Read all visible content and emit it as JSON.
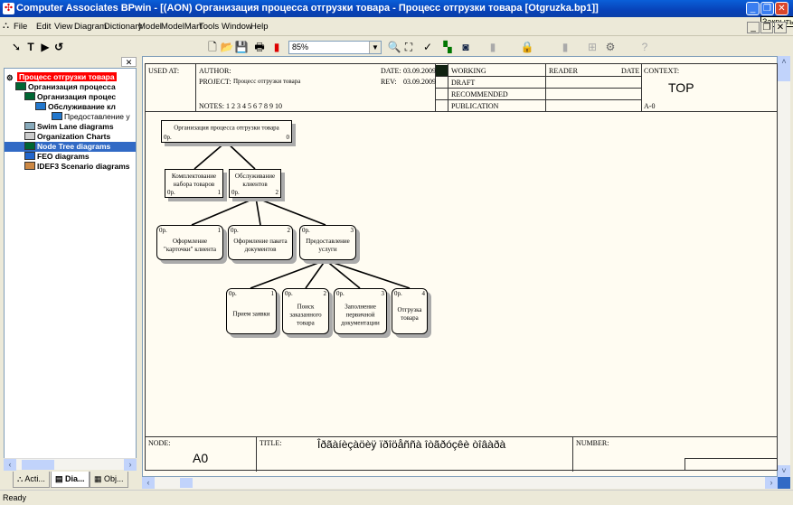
{
  "window": {
    "title": "Computer Associates BPwin - [(AON) Организация процесса отгрузки товара - Процесс отгрузки товара  [Otgruzka.bp1]]",
    "tooltip": "Закрыть"
  },
  "menu": [
    "File",
    "Edit",
    "View",
    "Diagram",
    "Dictionary",
    "Model",
    "ModelMart",
    "Tools",
    "Window",
    "Help"
  ],
  "toolbar": {
    "zoom": "85%"
  },
  "tree": {
    "items": [
      {
        "label": "Процесс отгрузки товара",
        "selected_red": true
      },
      {
        "label": "Организация процесса"
      },
      {
        "label": "Организация процес"
      },
      {
        "label": "Обслуживание кл"
      },
      {
        "label": "Предоставление у"
      },
      {
        "label": "Swim Lane diagrams"
      },
      {
        "label": "Organization Charts"
      },
      {
        "label": "Node Tree diagrams",
        "selected": true
      },
      {
        "label": "FEO diagrams"
      },
      {
        "label": "IDEF3 Scenario diagrams"
      }
    ],
    "tabs": [
      "Acti...",
      "Dia...",
      "Obj..."
    ]
  },
  "header": {
    "used_at": "USED AT:",
    "author": "AUTHOR:",
    "project_label": "PROJECT:",
    "project": "Процесс отгрузки товара",
    "date_label": "DATE:",
    "date": "03.09.2009",
    "rev_label": "REV:",
    "rev": "03.09.2009",
    "notes": "NOTES:  1  2  3  4  5  6  7  8  9  10",
    "status": [
      "WORKING",
      "DRAFT",
      "RECOMMENDED",
      "PUBLICATION"
    ],
    "reader": "READER",
    "reader_date": "DATE",
    "context": "CONTEXT:",
    "context_value": "TOP",
    "context_node": "A-0"
  },
  "footer": {
    "node_label": "NODE:",
    "node": "A0",
    "title_label": "TITLE:",
    "title": "Îðãàíèçàöèÿ ïðîöåññà îòãðóçêè òîâàðà",
    "number_label": "NUMBER:"
  },
  "diagram": {
    "op": "0р.",
    "nodes": [
      {
        "label": "Организация процесса отгрузки товара",
        "num": "0"
      },
      {
        "label": "Комплектование набора товаров",
        "num": "1"
      },
      {
        "label": "Обслуживание клиентов",
        "num": "2"
      },
      {
        "label": "Оформление \"карточки\" клиента",
        "num": "1"
      },
      {
        "label": "Оформление пакета документов",
        "num": "2"
      },
      {
        "label": "Предоставление услуги",
        "num": "3"
      },
      {
        "label": "Прием заявки",
        "num": "1"
      },
      {
        "label": "Поиск заказанного товара",
        "num": "2"
      },
      {
        "label": "Заполнение первичной документации",
        "num": "3"
      },
      {
        "label": "Отгрузка товара",
        "num": "4"
      }
    ]
  },
  "status": "Ready"
}
